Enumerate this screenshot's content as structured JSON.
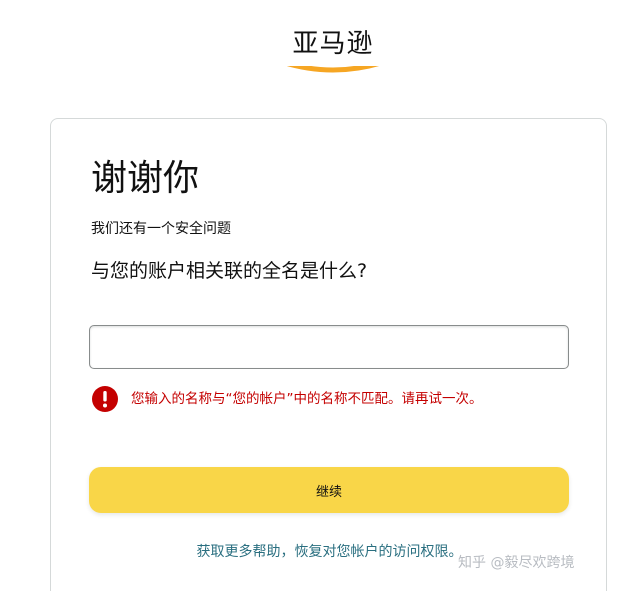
{
  "logo": {
    "text": "亚马逊",
    "icon": "amazon-smile-icon",
    "smile_color": "#f6a623"
  },
  "card": {
    "title": "谢谢你",
    "subtitle": "我们还有一个安全问题",
    "question": "与您的账户相关联的全名是什么?",
    "name_input": {
      "value": "",
      "placeholder": ""
    },
    "error": {
      "icon": "error-circle-icon",
      "text": "您输入的名称与“您的帐户”中的名称不匹配。请再试一次。",
      "color": "#c40000"
    },
    "continue_label": "继续",
    "continue_color": "#f9d648",
    "help_link": "获取更多帮助，恢复对您帐户的访问权限。"
  },
  "watermark": "知乎 @毅尽欢跨境"
}
